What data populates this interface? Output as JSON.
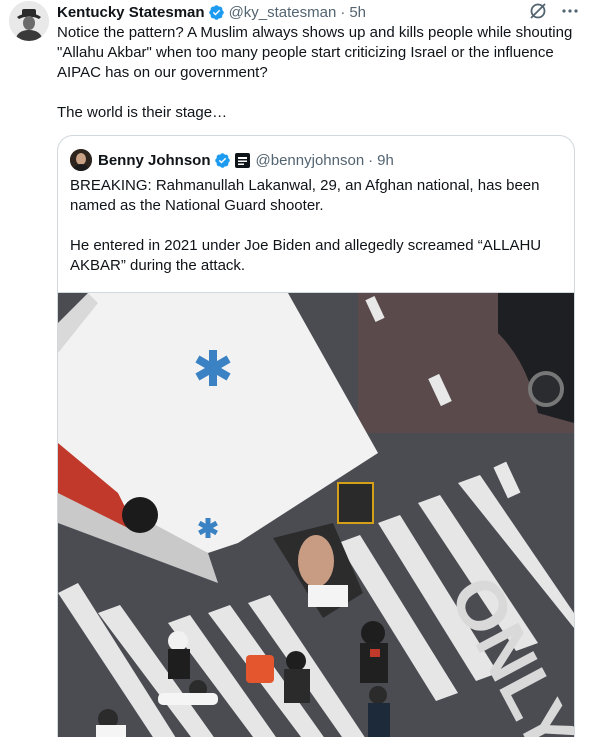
{
  "post": {
    "author_name": "Kentucky Statesman",
    "author_handle": "@ky_statesman",
    "separator": "·",
    "time": "5h",
    "text_paragraph_1": "Notice the pattern? A Muslim always shows up and kills people while shouting \"Allahu Akbar\" when too many people start criticizing Israel or the influence AIPAC has on our government?",
    "text_paragraph_2": "The world is their stage…"
  },
  "quote": {
    "author_name": "Benny Johnson",
    "author_handle": "@bennyjohnson",
    "separator": "·",
    "time": "9h",
    "text_paragraph_1": "BREAKING: Rahmanullah Lakanwal, 29, an Afghan national, has been named as the National Guard shooter.",
    "text_paragraph_2": "He entered in 2021 under Joe Biden and allegedly screamed “ALLAHU AKBAR” during the attack.",
    "media": {
      "road_marking_text": "ONLY"
    }
  },
  "colors": {
    "verified": "#1d9bf0",
    "secondary_text": "#536471",
    "border": "#cfd9de",
    "ambulance_cross": "#3b82c4",
    "ambulance_stripe": "#c0392b",
    "asphalt": "#4a4c52"
  },
  "icons": {
    "verified": "verified-badge-icon",
    "grok": "grok-icon",
    "more": "more-icon",
    "affiliate": "affiliate-badge-icon"
  }
}
